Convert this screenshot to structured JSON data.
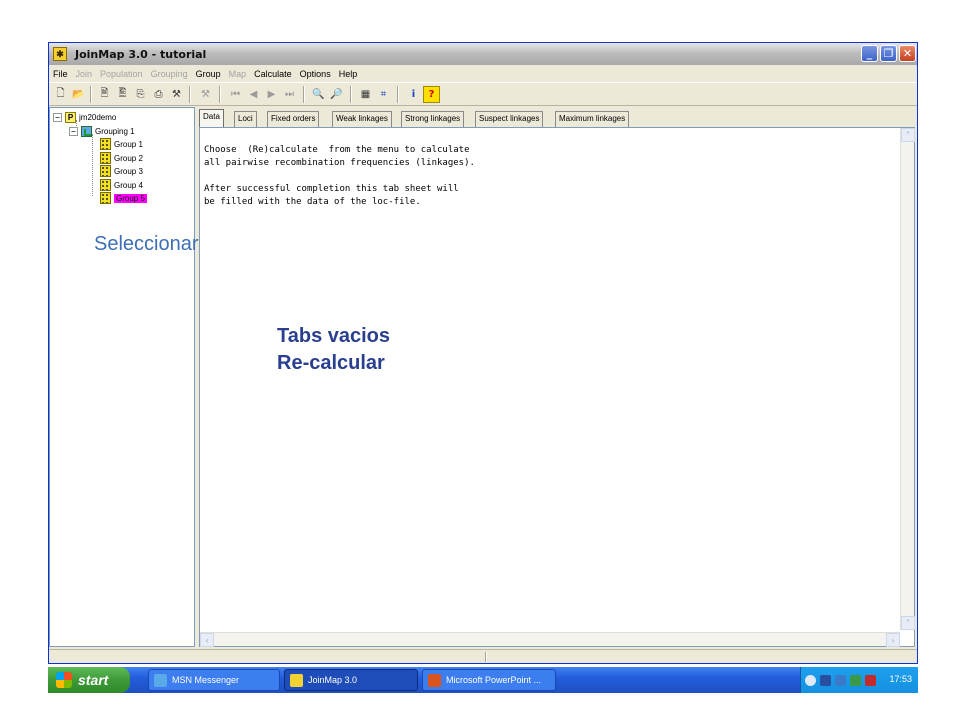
{
  "window": {
    "title": "JoinMap 3.0  -  tutorial",
    "controls": {
      "minimize": "_",
      "maximize": "❐",
      "close": "✕"
    }
  },
  "menu": [
    {
      "label": "File",
      "enabled": true
    },
    {
      "label": "Join",
      "enabled": false
    },
    {
      "label": "Population",
      "enabled": false
    },
    {
      "label": "Grouping",
      "enabled": false
    },
    {
      "label": "Group",
      "enabled": true
    },
    {
      "label": "Map",
      "enabled": false
    },
    {
      "label": "Calculate",
      "enabled": true
    },
    {
      "label": "Options",
      "enabled": true
    },
    {
      "label": "Help",
      "enabled": true
    }
  ],
  "tree": {
    "root": "jm20demo",
    "grouping": "Grouping 1",
    "groups": [
      "Group 1",
      "Group 2",
      "Group 3",
      "Group 4",
      "Group 5"
    ],
    "selected_group": "Group 5",
    "highlight_color": "#ff00ff"
  },
  "tabs": [
    {
      "label": "Data",
      "active": true
    },
    {
      "label": "Loci",
      "active": false
    },
    {
      "label": "Fixed orders",
      "active": false
    },
    {
      "label": "Weak linkages",
      "active": false
    },
    {
      "label": "Strong linkages",
      "active": false
    },
    {
      "label": "Suspect linkages",
      "active": false
    },
    {
      "label": "Maximum linkages",
      "active": false
    }
  ],
  "content": {
    "line1": "Choose  (Re)calculate  from the menu to calculate",
    "line2": "all pairwise recombination frequencies (linkages).",
    "line3": "After successful completion this tab sheet will",
    "line4": "be filled with the data of the loc-file."
  },
  "annotations": {
    "seleccionar": "Seleccionar",
    "tabs_vacios": "Tabs vacios",
    "recalcular": "Re-calcular"
  },
  "taskbar": {
    "start": "start",
    "items": [
      {
        "label": "MSN Messenger",
        "active": false
      },
      {
        "label": "JoinMap 3.0",
        "active": true
      },
      {
        "label": "Microsoft PowerPoint ...",
        "active": false
      }
    ],
    "clock": "17:53"
  }
}
